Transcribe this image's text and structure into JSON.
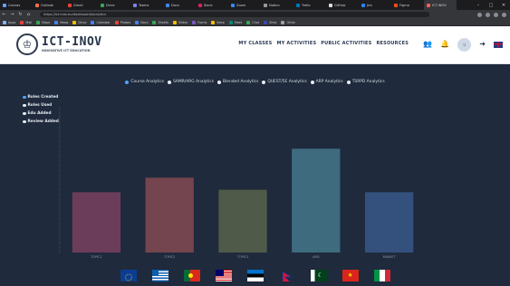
{
  "browser": {
    "tabs": [
      {
        "label": "Canvas",
        "color": "#6aa0ff",
        "active": false
      },
      {
        "label": "Outlook",
        "color": "#ff7043",
        "active": false
      },
      {
        "label": "Gmail",
        "color": "#ea4335",
        "active": false
      },
      {
        "label": "Drive",
        "color": "#34a853",
        "active": false
      },
      {
        "label": "Teams",
        "color": "#7b83eb",
        "active": false
      },
      {
        "label": "Docs",
        "color": "#4285f4",
        "active": false
      },
      {
        "label": "Slack",
        "color": "#e01e5a",
        "active": false
      },
      {
        "label": "Zoom",
        "color": "#2d8cff",
        "active": false
      },
      {
        "label": "Notion",
        "color": "#999999",
        "active": false
      },
      {
        "label": "Trello",
        "color": "#0079bf",
        "active": false
      },
      {
        "label": "GitHub",
        "color": "#dddddd",
        "active": false
      },
      {
        "label": "Jira",
        "color": "#2684ff",
        "active": false
      },
      {
        "label": "Figma",
        "color": "#f24e1e",
        "active": false
      },
      {
        "label": "ICT-INOV",
        "color": "#ff5b5b",
        "active": true
      }
    ],
    "url": "https://ict-inov.eu/dashboard/analytics",
    "bookmarks": [
      {
        "label": "Apps",
        "color": "#8ab4f8"
      },
      {
        "label": "Mail",
        "color": "#ea4335"
      },
      {
        "label": "Maps",
        "color": "#34a853"
      },
      {
        "label": "News",
        "color": "#4285f4"
      },
      {
        "label": "Drive",
        "color": "#fbbc05"
      },
      {
        "label": "Calendar",
        "color": "#4285f4"
      },
      {
        "label": "Photos",
        "color": "#ea4335"
      },
      {
        "label": "Docs",
        "color": "#4285f4"
      },
      {
        "label": "Sheets",
        "color": "#34a853"
      },
      {
        "label": "Slides",
        "color": "#fbbc05"
      },
      {
        "label": "Forms",
        "color": "#7e57c2"
      },
      {
        "label": "Keep",
        "color": "#fbbc05"
      },
      {
        "label": "Meet",
        "color": "#00897b"
      },
      {
        "label": "Chat",
        "color": "#34a853"
      },
      {
        "label": "Sites",
        "color": "#3949ab"
      },
      {
        "label": "Other",
        "color": "#9aa0a6"
      }
    ]
  },
  "header": {
    "logo_title": "ICT-INOV",
    "logo_subtitle": "INNOVATIVE ICT EDUCATION",
    "nav": [
      "MY CLASSES",
      "MY ACTIVITIES",
      "PUBLIC ACTIVITIES",
      "RESOURCES"
    ],
    "avatar_initials": "U"
  },
  "legend": [
    {
      "label": "Course Analytics",
      "active": true
    },
    {
      "label": "SAMR/ARG Analytics",
      "active": false
    },
    {
      "label": "Blended Analytics",
      "active": false
    },
    {
      "label": "QUEST/5E Analytics",
      "active": false
    },
    {
      "label": "ARP Analytics",
      "active": false
    },
    {
      "label": "TSRPD Analytics",
      "active": false
    }
  ],
  "filters": [
    {
      "label": "Roles Created",
      "active": true
    },
    {
      "label": "Roles Used",
      "active": false
    },
    {
      "label": "Edu Added",
      "active": false
    },
    {
      "label": "Review Added",
      "active": false
    }
  ],
  "chart_data": {
    "type": "bar",
    "title": "",
    "categories": [
      "TOPIC1",
      "TOPIC2",
      "TOPIC3",
      "ARD",
      "MARKET"
    ],
    "values": [
      25,
      31,
      26,
      43,
      25
    ],
    "colors": [
      "#6b3d5a",
      "#74454f",
      "#4f5a49",
      "#3f6b7e",
      "#34507d"
    ],
    "ylim": [
      0,
      60
    ],
    "grid": false
  },
  "flags": [
    "eu",
    "greece",
    "portugal",
    "malaysia",
    "estonia",
    "nepal",
    "pakistan",
    "vietnam",
    "italy"
  ]
}
